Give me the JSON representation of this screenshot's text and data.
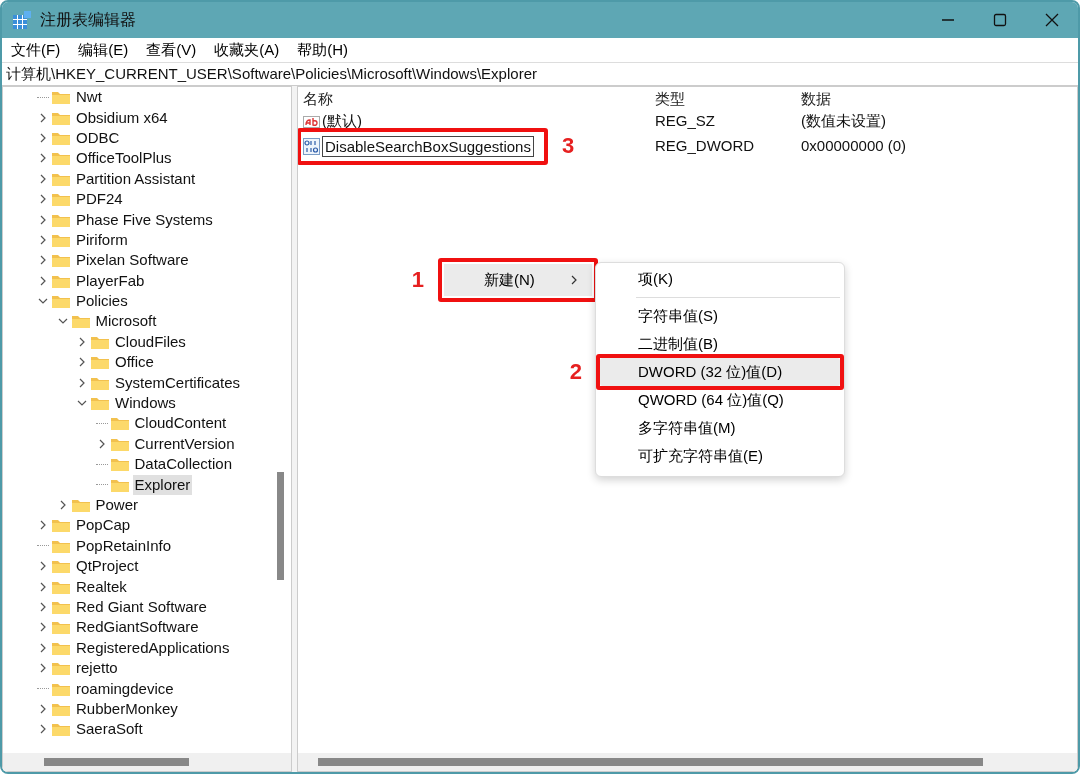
{
  "window": {
    "title": "注册表编辑器"
  },
  "menu": [
    "文件(F)",
    "编辑(E)",
    "查看(V)",
    "收藏夹(A)",
    "帮助(H)"
  ],
  "address": "计算机\\HKEY_CURRENT_USER\\Software\\Policies\\Microsoft\\Windows\\Explorer",
  "tree": [
    {
      "label": "Nwt",
      "kind": "leaf",
      "selected": false
    },
    {
      "label": "Obsidium x64",
      "kind": "branch",
      "expanded": false,
      "selected": false
    },
    {
      "label": "ODBC",
      "kind": "branch",
      "expanded": false,
      "selected": false
    },
    {
      "label": "OfficeToolPlus",
      "kind": "branch",
      "expanded": false,
      "selected": false
    },
    {
      "label": "Partition Assistant",
      "kind": "branch",
      "expanded": false,
      "selected": false
    },
    {
      "label": "PDF24",
      "kind": "branch",
      "expanded": false,
      "selected": false
    },
    {
      "label": "Phase Five Systems",
      "kind": "branch",
      "expanded": false,
      "selected": false
    },
    {
      "label": "Piriform",
      "kind": "branch",
      "expanded": false,
      "selected": false
    },
    {
      "label": "Pixelan Software",
      "kind": "branch",
      "expanded": false,
      "selected": false
    },
    {
      "label": "PlayerFab",
      "kind": "branch",
      "expanded": false,
      "selected": false
    },
    {
      "label": "Policies",
      "kind": "branch",
      "expanded": true,
      "selected": false,
      "children": [
        {
          "label": "Microsoft",
          "kind": "branch",
          "expanded": true,
          "selected": false,
          "children": [
            {
              "label": "CloudFiles",
              "kind": "branch",
              "expanded": false,
              "selected": false
            },
            {
              "label": "Office",
              "kind": "branch",
              "expanded": false,
              "selected": false
            },
            {
              "label": "SystemCertificates",
              "kind": "branch",
              "expanded": false,
              "selected": false
            },
            {
              "label": "Windows",
              "kind": "branch",
              "expanded": true,
              "selected": false,
              "children": [
                {
                  "label": "CloudContent",
                  "kind": "leaf",
                  "selected": false
                },
                {
                  "label": "CurrentVersion",
                  "kind": "branch",
                  "expanded": false,
                  "selected": false
                },
                {
                  "label": "DataCollection",
                  "kind": "leaf",
                  "selected": false
                },
                {
                  "label": "Explorer",
                  "kind": "leaf",
                  "selected": true
                }
              ]
            }
          ]
        },
        {
          "label": "Power",
          "kind": "branch",
          "expanded": false,
          "selected": false
        }
      ]
    },
    {
      "label": "PopCap",
      "kind": "branch",
      "expanded": false,
      "selected": false
    },
    {
      "label": "PopRetainInfo",
      "kind": "leaf",
      "selected": false
    },
    {
      "label": "QtProject",
      "kind": "branch",
      "expanded": false,
      "selected": false
    },
    {
      "label": "Realtek",
      "kind": "branch",
      "expanded": false,
      "selected": false
    },
    {
      "label": "Red Giant Software",
      "kind": "branch",
      "expanded": false,
      "selected": false
    },
    {
      "label": "RedGiantSoftware",
      "kind": "branch",
      "expanded": false,
      "selected": false
    },
    {
      "label": "RegisteredApplications",
      "kind": "branch",
      "expanded": false,
      "selected": false
    },
    {
      "label": "rejetto",
      "kind": "branch",
      "expanded": false,
      "selected": false
    },
    {
      "label": "roamingdevice",
      "kind": "leaf",
      "selected": false
    },
    {
      "label": "RubberMonkey",
      "kind": "branch",
      "expanded": false,
      "selected": false
    },
    {
      "label": "SaeraSoft",
      "kind": "branch",
      "expanded": false,
      "selected": false
    }
  ],
  "values": {
    "columns": [
      "名称",
      "类型",
      "数据"
    ],
    "rows": [
      {
        "kind": "string",
        "name": "(默认)",
        "type": "REG_SZ",
        "data": "(数值未设置)",
        "editing": false
      },
      {
        "kind": "dword",
        "name": "DisableSearchBoxSuggestions",
        "type": "REG_DWORD",
        "data": "0x00000000 (0)",
        "editing": true,
        "annotation": "3"
      }
    ]
  },
  "context_menu": {
    "items": [
      {
        "label": "新建(N)",
        "has_submenu": true,
        "selected": true,
        "annotation": "1"
      }
    ]
  },
  "submenu": {
    "items": [
      {
        "kind": "item",
        "label": "项(K)",
        "selected": false
      },
      {
        "kind": "separator"
      },
      {
        "kind": "item",
        "label": "字符串值(S)",
        "selected": false
      },
      {
        "kind": "item",
        "label": "二进制值(B)",
        "selected": false
      },
      {
        "kind": "item",
        "label": "DWORD (32 位)值(D)",
        "selected": true,
        "annotation": "2"
      },
      {
        "kind": "item",
        "label": "QWORD (64 位)值(Q)",
        "selected": false
      },
      {
        "kind": "item",
        "label": "多字符串值(M)",
        "selected": false
      },
      {
        "kind": "item",
        "label": "可扩充字符串值(E)",
        "selected": false
      }
    ]
  }
}
